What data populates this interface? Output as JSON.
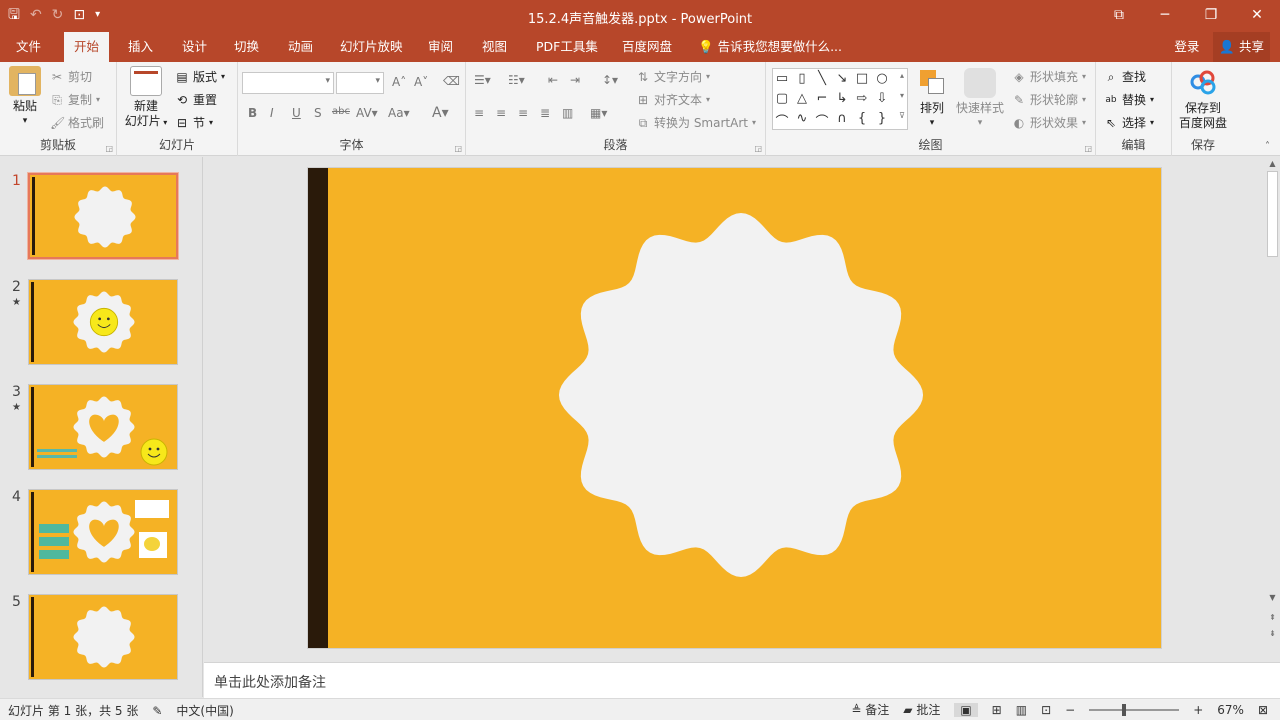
{
  "window": {
    "title": "15.2.4声音触发器.pptx - PowerPoint"
  },
  "tabs": [
    "文件",
    "开始",
    "插入",
    "设计",
    "切换",
    "动画",
    "幻灯片放映",
    "审阅",
    "视图",
    "PDF工具集",
    "百度网盘"
  ],
  "tell_me": "告诉我您想要做什么...",
  "account": {
    "login": "登录",
    "share": "共享"
  },
  "ribbon": {
    "clipboard": {
      "label": "剪贴板",
      "paste": "粘贴",
      "cut": "剪切",
      "copy": "复制",
      "format_painter": "格式刷"
    },
    "slides": {
      "label": "幻灯片",
      "new_slide_1": "新建",
      "new_slide_2": "幻灯片",
      "layout": "版式",
      "reset": "重置",
      "section": "节"
    },
    "font": {
      "label": "字体"
    },
    "paragraph": {
      "label": "段落",
      "text_direction": "文字方向",
      "align_text": "对齐文本",
      "smartart": "转换为 SmartArt"
    },
    "drawing": {
      "label": "绘图",
      "arrange": "排列",
      "quick_styles": "快速样式",
      "shape_fill": "形状填充",
      "shape_outline": "形状轮廓",
      "shape_effects": "形状效果"
    },
    "editing": {
      "label": "编辑",
      "find": "查找",
      "replace": "替换",
      "select": "选择"
    },
    "save": {
      "label": "保存",
      "btn_1": "保存到",
      "btn_2": "百度网盘"
    }
  },
  "thumbnails": [
    {
      "num": "1",
      "starred": false
    },
    {
      "num": "2",
      "starred": true
    },
    {
      "num": "3",
      "starred": true
    },
    {
      "num": "4",
      "starred": false
    },
    {
      "num": "5",
      "starred": false
    }
  ],
  "notes_placeholder": "单击此处添加备注",
  "status": {
    "slide_info": "幻灯片 第 1 张，共 5 张",
    "language": "中文(中国)",
    "notes": "备注",
    "comments": "批注",
    "zoom": "67%"
  },
  "colors": {
    "accent": "#b7472a",
    "slide_bg": "#f5b225",
    "stripe": "#2a1a0a",
    "badge": "#f2f2f2"
  }
}
